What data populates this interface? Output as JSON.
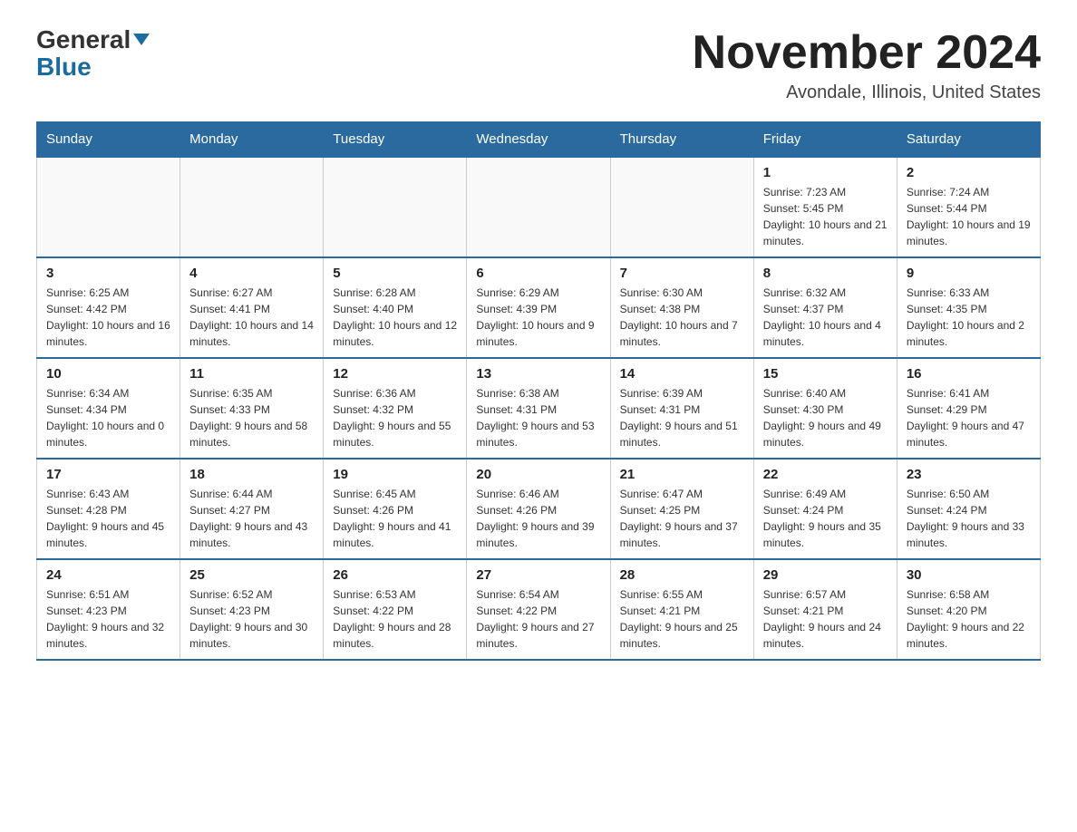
{
  "header": {
    "logo_general": "General",
    "logo_blue": "Blue",
    "month_title": "November 2024",
    "location": "Avondale, Illinois, United States"
  },
  "days_of_week": [
    "Sunday",
    "Monday",
    "Tuesday",
    "Wednesday",
    "Thursday",
    "Friday",
    "Saturday"
  ],
  "weeks": [
    [
      {
        "day": "",
        "info": ""
      },
      {
        "day": "",
        "info": ""
      },
      {
        "day": "",
        "info": ""
      },
      {
        "day": "",
        "info": ""
      },
      {
        "day": "",
        "info": ""
      },
      {
        "day": "1",
        "info": "Sunrise: 7:23 AM\nSunset: 5:45 PM\nDaylight: 10 hours and 21 minutes."
      },
      {
        "day": "2",
        "info": "Sunrise: 7:24 AM\nSunset: 5:44 PM\nDaylight: 10 hours and 19 minutes."
      }
    ],
    [
      {
        "day": "3",
        "info": "Sunrise: 6:25 AM\nSunset: 4:42 PM\nDaylight: 10 hours and 16 minutes."
      },
      {
        "day": "4",
        "info": "Sunrise: 6:27 AM\nSunset: 4:41 PM\nDaylight: 10 hours and 14 minutes."
      },
      {
        "day": "5",
        "info": "Sunrise: 6:28 AM\nSunset: 4:40 PM\nDaylight: 10 hours and 12 minutes."
      },
      {
        "day": "6",
        "info": "Sunrise: 6:29 AM\nSunset: 4:39 PM\nDaylight: 10 hours and 9 minutes."
      },
      {
        "day": "7",
        "info": "Sunrise: 6:30 AM\nSunset: 4:38 PM\nDaylight: 10 hours and 7 minutes."
      },
      {
        "day": "8",
        "info": "Sunrise: 6:32 AM\nSunset: 4:37 PM\nDaylight: 10 hours and 4 minutes."
      },
      {
        "day": "9",
        "info": "Sunrise: 6:33 AM\nSunset: 4:35 PM\nDaylight: 10 hours and 2 minutes."
      }
    ],
    [
      {
        "day": "10",
        "info": "Sunrise: 6:34 AM\nSunset: 4:34 PM\nDaylight: 10 hours and 0 minutes."
      },
      {
        "day": "11",
        "info": "Sunrise: 6:35 AM\nSunset: 4:33 PM\nDaylight: 9 hours and 58 minutes."
      },
      {
        "day": "12",
        "info": "Sunrise: 6:36 AM\nSunset: 4:32 PM\nDaylight: 9 hours and 55 minutes."
      },
      {
        "day": "13",
        "info": "Sunrise: 6:38 AM\nSunset: 4:31 PM\nDaylight: 9 hours and 53 minutes."
      },
      {
        "day": "14",
        "info": "Sunrise: 6:39 AM\nSunset: 4:31 PM\nDaylight: 9 hours and 51 minutes."
      },
      {
        "day": "15",
        "info": "Sunrise: 6:40 AM\nSunset: 4:30 PM\nDaylight: 9 hours and 49 minutes."
      },
      {
        "day": "16",
        "info": "Sunrise: 6:41 AM\nSunset: 4:29 PM\nDaylight: 9 hours and 47 minutes."
      }
    ],
    [
      {
        "day": "17",
        "info": "Sunrise: 6:43 AM\nSunset: 4:28 PM\nDaylight: 9 hours and 45 minutes."
      },
      {
        "day": "18",
        "info": "Sunrise: 6:44 AM\nSunset: 4:27 PM\nDaylight: 9 hours and 43 minutes."
      },
      {
        "day": "19",
        "info": "Sunrise: 6:45 AM\nSunset: 4:26 PM\nDaylight: 9 hours and 41 minutes."
      },
      {
        "day": "20",
        "info": "Sunrise: 6:46 AM\nSunset: 4:26 PM\nDaylight: 9 hours and 39 minutes."
      },
      {
        "day": "21",
        "info": "Sunrise: 6:47 AM\nSunset: 4:25 PM\nDaylight: 9 hours and 37 minutes."
      },
      {
        "day": "22",
        "info": "Sunrise: 6:49 AM\nSunset: 4:24 PM\nDaylight: 9 hours and 35 minutes."
      },
      {
        "day": "23",
        "info": "Sunrise: 6:50 AM\nSunset: 4:24 PM\nDaylight: 9 hours and 33 minutes."
      }
    ],
    [
      {
        "day": "24",
        "info": "Sunrise: 6:51 AM\nSunset: 4:23 PM\nDaylight: 9 hours and 32 minutes."
      },
      {
        "day": "25",
        "info": "Sunrise: 6:52 AM\nSunset: 4:23 PM\nDaylight: 9 hours and 30 minutes."
      },
      {
        "day": "26",
        "info": "Sunrise: 6:53 AM\nSunset: 4:22 PM\nDaylight: 9 hours and 28 minutes."
      },
      {
        "day": "27",
        "info": "Sunrise: 6:54 AM\nSunset: 4:22 PM\nDaylight: 9 hours and 27 minutes."
      },
      {
        "day": "28",
        "info": "Sunrise: 6:55 AM\nSunset: 4:21 PM\nDaylight: 9 hours and 25 minutes."
      },
      {
        "day": "29",
        "info": "Sunrise: 6:57 AM\nSunset: 4:21 PM\nDaylight: 9 hours and 24 minutes."
      },
      {
        "day": "30",
        "info": "Sunrise: 6:58 AM\nSunset: 4:20 PM\nDaylight: 9 hours and 22 minutes."
      }
    ]
  ]
}
